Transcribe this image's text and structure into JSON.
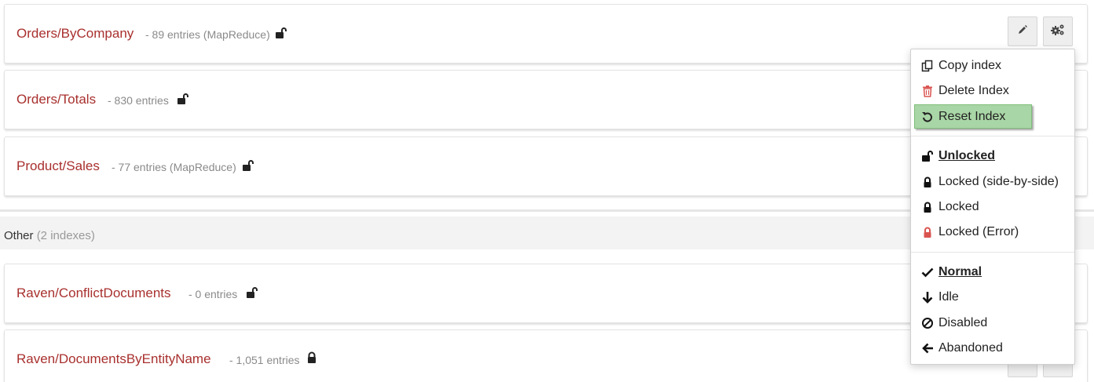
{
  "indexes": [
    {
      "name": "Orders/ByCompany",
      "meta": "- 89 entries (MapReduce)",
      "lock": "unlocked-icon"
    },
    {
      "name": "Orders/Totals",
      "meta": "- 830 entries",
      "lock": "unlocked-icon"
    },
    {
      "name": "Product/Sales",
      "meta": "- 77 entries (MapReduce)",
      "lock": "unlocked-icon"
    },
    {
      "name": "Raven/ConflictDocuments",
      "meta": "- 0 entries",
      "lock": "unlocked-icon"
    },
    {
      "name": "Raven/DocumentsByEntityName",
      "meta": "- 1,051 entries",
      "lock": "locked-icon"
    }
  ],
  "group": {
    "title": "Other",
    "count": "(2 indexes)"
  },
  "buttons": {
    "edit_icon": "pencil-icon",
    "settings_icon": "gears-icon"
  },
  "menu": {
    "actions": [
      {
        "label": "Copy index",
        "icon": "copy-icon"
      },
      {
        "label": "Delete Index",
        "icon": "trash-icon"
      },
      {
        "label": "Reset Index",
        "icon": "reset-icon",
        "hovered": true
      }
    ],
    "lock_modes": [
      {
        "label": " Unlocked",
        "icon": "unlocked-icon",
        "active": true
      },
      {
        "label": "Locked (side-by-side)",
        "icon": "lock-icon"
      },
      {
        "label": "Locked",
        "icon": "lock-icon"
      },
      {
        "label": "Locked (Error)",
        "icon": "lock-error-icon"
      }
    ],
    "priorities": [
      {
        "label": " Normal",
        "icon": "check-icon",
        "active": true
      },
      {
        "label": "Idle",
        "icon": "arrow-down-icon"
      },
      {
        "label": "Disabled",
        "icon": "ban-icon"
      },
      {
        "label": "Abandoned",
        "icon": "arrow-left-icon"
      }
    ]
  },
  "colors": {
    "index_name": "#a8302e",
    "meta_text": "#8a8a8a",
    "hover_bg": "#a9d6a6",
    "delete_icon": "#d9534f",
    "lock_error": "#d9534f"
  }
}
